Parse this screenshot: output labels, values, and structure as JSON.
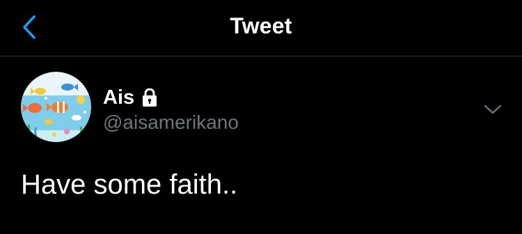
{
  "header": {
    "title": "Tweet",
    "back_icon": "chevron-left-icon",
    "accent_color": "#1d9bf0"
  },
  "tweet": {
    "author": {
      "display_name": "Ais",
      "handle": "@aisamerikano",
      "protected_icon": "lock-icon",
      "avatar": "tropical-fish-illustration"
    },
    "more_icon": "chevron-down-icon",
    "text": "Have some faith.."
  }
}
